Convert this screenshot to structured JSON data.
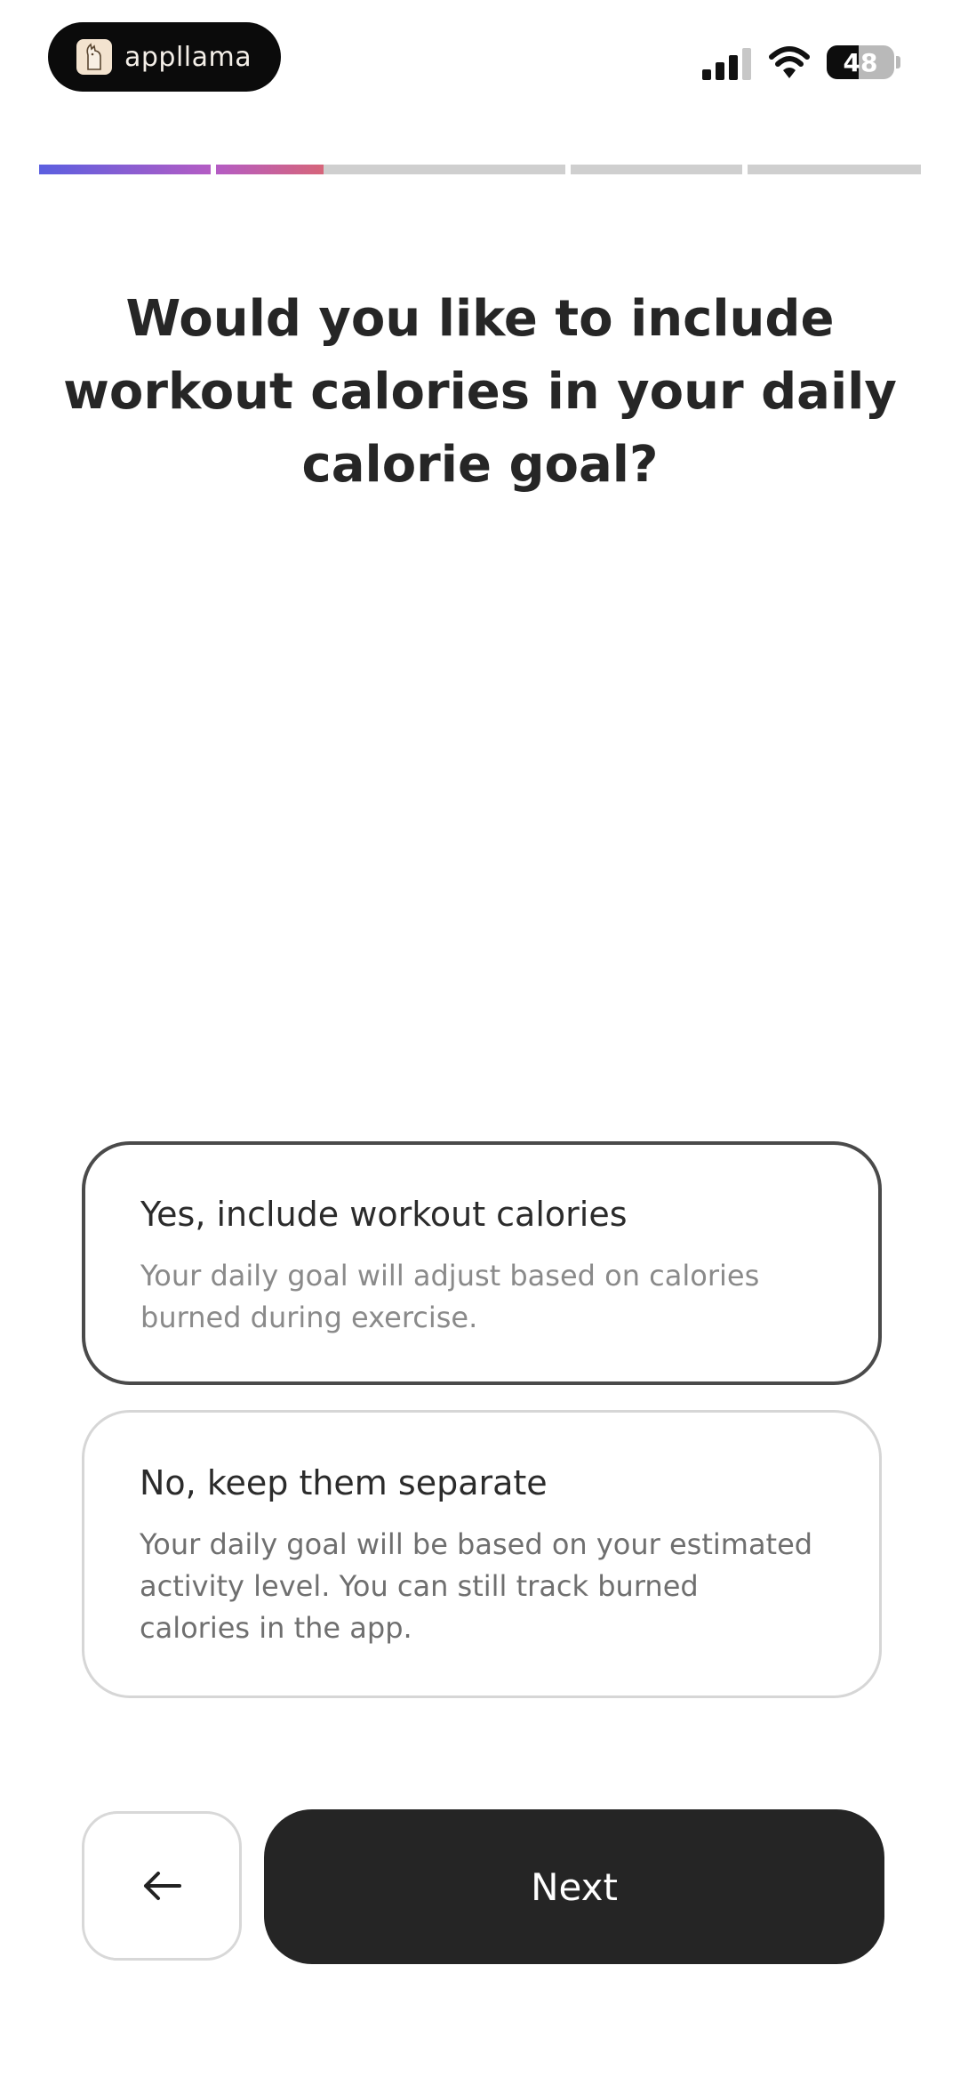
{
  "status_bar": {
    "app_name": "appllama",
    "battery_level": "48",
    "battery_fraction": 0.48,
    "signal_bars_active": 3,
    "signal_bars_total": 4
  },
  "progress": {
    "segments": [
      {
        "fill": 1.0,
        "color": "#7a5ad6"
      },
      {
        "fill": 1.0,
        "color": "#c0597a"
      },
      {
        "fill": 0.0,
        "color": "#cfcfcf"
      },
      {
        "fill": 0.0,
        "color": "#cfcfcf"
      },
      {
        "fill": 0.0,
        "color": "#cfcfcf"
      }
    ]
  },
  "question": {
    "text": "Would you like to include workout calories in your daily calorie goal?"
  },
  "options": [
    {
      "title": "Yes, include workout calories",
      "description": "Your daily goal will adjust based on calories burned during exercise.",
      "selected": true
    },
    {
      "title": "No, keep them separate",
      "description": "Your daily goal will be based on your estimated activity level. You can still track burned calories in the app.",
      "selected": false
    }
  ],
  "buttons": {
    "back_icon": "arrow-left-icon",
    "next_label": "Next"
  },
  "colors": {
    "primary_dark": "#252525",
    "selected_border": "#4a4a4a",
    "unselected_border": "#d6d6d6",
    "progress_gradient_start": "#5b5fe0",
    "progress_gradient_mid": "#b45cc4",
    "progress_gradient_end": "#d6657a"
  }
}
